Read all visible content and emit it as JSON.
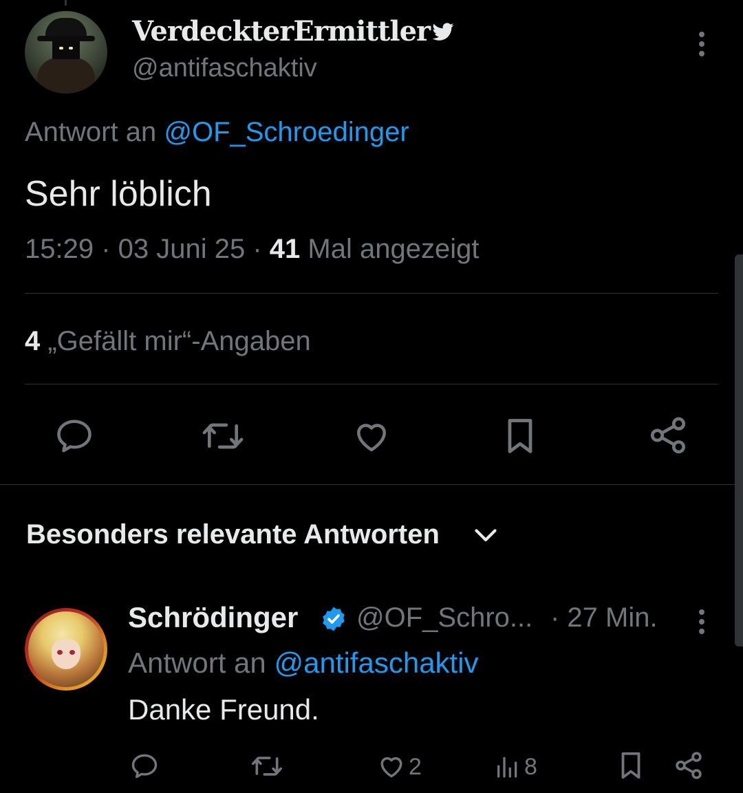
{
  "tweet": {
    "display_name": "VerdeckterErmittler",
    "handle": "@antifaschaktiv",
    "reply_prefix": "Antwort an",
    "reply_mention": "@OF_Schroedinger",
    "text": "Sehr löblich",
    "time": "15:29",
    "sep1": " · ",
    "date": "03 Juni 25",
    "sep2": " · ",
    "views_count": "41",
    "views_label": " Mal angezeigt",
    "likes_count": "4",
    "likes_label": " „Gefällt mir“-Angaben",
    "actions": [
      "reply-icon",
      "retweet-icon",
      "like-icon",
      "bookmark-icon",
      "share-icon"
    ]
  },
  "replies_section": {
    "title": "Besonders relevante Antworten"
  },
  "reply": {
    "display_name": "Schrödinger",
    "handle": "@OF_Schro...",
    "time": "· 27 Min.",
    "reply_prefix": "Antwort an",
    "reply_mention": "@antifaschaktiv",
    "text": "Danke Freund.",
    "likes": "2",
    "views": "8"
  },
  "colors": {
    "background": "#000000",
    "text": "#e7e9ea",
    "secondary": "#71767b",
    "accent": "#1d9bf0",
    "divider": "#2f3336"
  }
}
